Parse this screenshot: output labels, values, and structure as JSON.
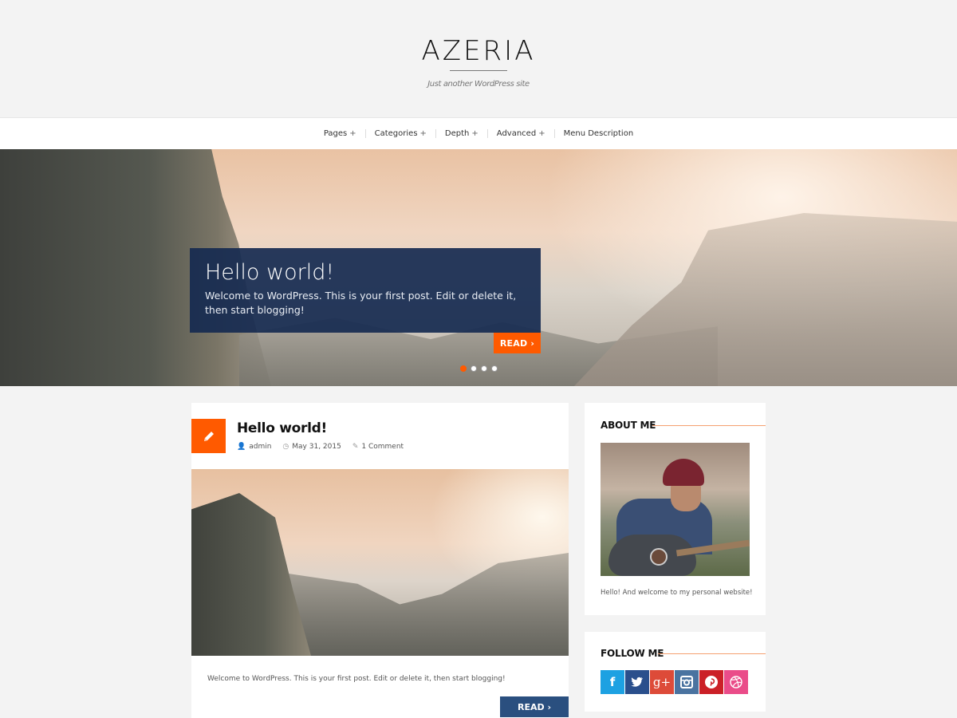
{
  "site": {
    "title": "AZERIA",
    "tagline": "Just another WordPress site"
  },
  "nav": {
    "items": [
      {
        "label": "Pages",
        "has_children": true
      },
      {
        "label": "Categories",
        "has_children": true
      },
      {
        "label": "Depth",
        "has_children": true
      },
      {
        "label": "Advanced",
        "has_children": true
      },
      {
        "label": "Menu Description",
        "has_children": false
      }
    ],
    "plus_glyph": "+"
  },
  "slider": {
    "title": "Hello world!",
    "excerpt": "Welcome to WordPress. This is your first post. Edit or delete it, then start blogging!",
    "read_label": "READ ›",
    "slide_count": 4,
    "active_slide": 1
  },
  "post": {
    "icon": "pencil-icon",
    "title": "Hello world!",
    "author": "admin",
    "date": "May 31, 2015",
    "comments": "1 Comment",
    "excerpt": "Welcome to WordPress. This is your first post. Edit or delete it, then start blogging!",
    "read_label": "READ ›"
  },
  "sidebar": {
    "about": {
      "title": "ABOUT ME",
      "text": "Hello! And welcome to my personal website!"
    },
    "follow": {
      "title": "FOLLOW ME",
      "networks": [
        {
          "name": "facebook",
          "glyph": "f",
          "color": "#1da1e2"
        },
        {
          "name": "twitter",
          "glyph": "🐦",
          "color": "#2a4f8c"
        },
        {
          "name": "google-plus",
          "glyph": "g+",
          "color": "#dd4b39"
        },
        {
          "name": "instagram",
          "glyph": "◙",
          "color": "#4a73a0"
        },
        {
          "name": "pinterest",
          "glyph": "P",
          "color": "#cb2027"
        },
        {
          "name": "dribbble",
          "glyph": "◎",
          "color": "#ea4c89"
        }
      ]
    }
  },
  "colors": {
    "accent": "#ff5a00",
    "caption_bg": "#162a50",
    "read_button_blue": "#2a4f7f",
    "widget_line": "#f5a070"
  }
}
